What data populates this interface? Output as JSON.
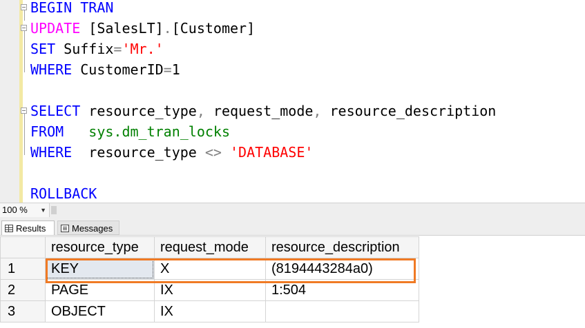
{
  "editor": {
    "lines": [
      [
        {
          "t": "BEGIN TRAN",
          "c": "kw"
        }
      ],
      [
        {
          "t": "UPDATE",
          "c": "fn"
        },
        {
          "t": " [SalesLT]",
          "c": "plain"
        },
        {
          "t": ".",
          "c": "op"
        },
        {
          "t": "[Customer]",
          "c": "plain"
        }
      ],
      [
        {
          "t": "SET",
          "c": "kw"
        },
        {
          "t": " Suffix",
          "c": "plain"
        },
        {
          "t": "=",
          "c": "op"
        },
        {
          "t": "'Mr.'",
          "c": "str"
        }
      ],
      [
        {
          "t": "WHERE",
          "c": "kw"
        },
        {
          "t": " CustomerID",
          "c": "plain"
        },
        {
          "t": "=",
          "c": "op"
        },
        {
          "t": "1",
          "c": "plain"
        }
      ],
      [],
      [
        {
          "t": "SELECT",
          "c": "kw"
        },
        {
          "t": " resource_type",
          "c": "plain"
        },
        {
          "t": ",",
          "c": "op"
        },
        {
          "t": " request_mode",
          "c": "plain"
        },
        {
          "t": ",",
          "c": "op"
        },
        {
          "t": " resource_description",
          "c": "plain"
        }
      ],
      [
        {
          "t": "FROM",
          "c": "kw"
        },
        {
          "t": "   sys.dm_tran_locks",
          "c": "sys"
        }
      ],
      [
        {
          "t": "WHERE",
          "c": "kw"
        },
        {
          "t": "  resource_type ",
          "c": "plain"
        },
        {
          "t": "<>",
          "c": "op"
        },
        {
          "t": " 'DATABASE'",
          "c": "str"
        }
      ],
      [],
      [
        {
          "t": "ROLLBACK",
          "c": "kw"
        }
      ]
    ]
  },
  "zoom": {
    "value": "100 %"
  },
  "tabs": {
    "results_label": "Results",
    "messages_label": "Messages"
  },
  "results": {
    "columns": [
      "resource_type",
      "request_mode",
      "resource_description"
    ],
    "rows": [
      {
        "num": "1",
        "cells": [
          "KEY",
          "X",
          "(8194443284a0)"
        ]
      },
      {
        "num": "2",
        "cells": [
          "PAGE",
          "IX",
          "1:504"
        ]
      },
      {
        "num": "3",
        "cells": [
          "OBJECT",
          "IX",
          ""
        ]
      }
    ]
  },
  "colors": {
    "keyword": "#0000ff",
    "function": "#ff00ff",
    "string": "#ff0000",
    "system": "#008000",
    "highlight": "#f07a24"
  }
}
